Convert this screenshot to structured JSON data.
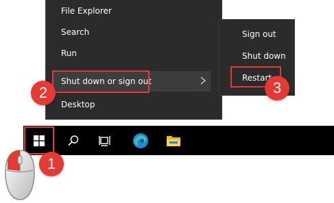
{
  "start_menu": {
    "items": [
      {
        "label": "File Explorer"
      },
      {
        "label": "Search"
      },
      {
        "label": "Run"
      },
      {
        "label": "Shut down or sign out"
      },
      {
        "label": "Desktop"
      }
    ]
  },
  "submenu": {
    "items": [
      {
        "label": "Sign out"
      },
      {
        "label": "Shut down"
      },
      {
        "label": "Restart"
      }
    ]
  },
  "steps": {
    "step1": "1",
    "step2": "2",
    "step3": "3"
  },
  "taskbar": {
    "icons": [
      "windows-start-icon",
      "search-icon",
      "task-view-icon",
      "edge-browser-icon",
      "file-explorer-icon"
    ]
  },
  "colors": {
    "menu_bg": "#2b2b2b",
    "taskbar_bg": "#000000",
    "highlight": "#e53935",
    "text": "#ffffff"
  }
}
